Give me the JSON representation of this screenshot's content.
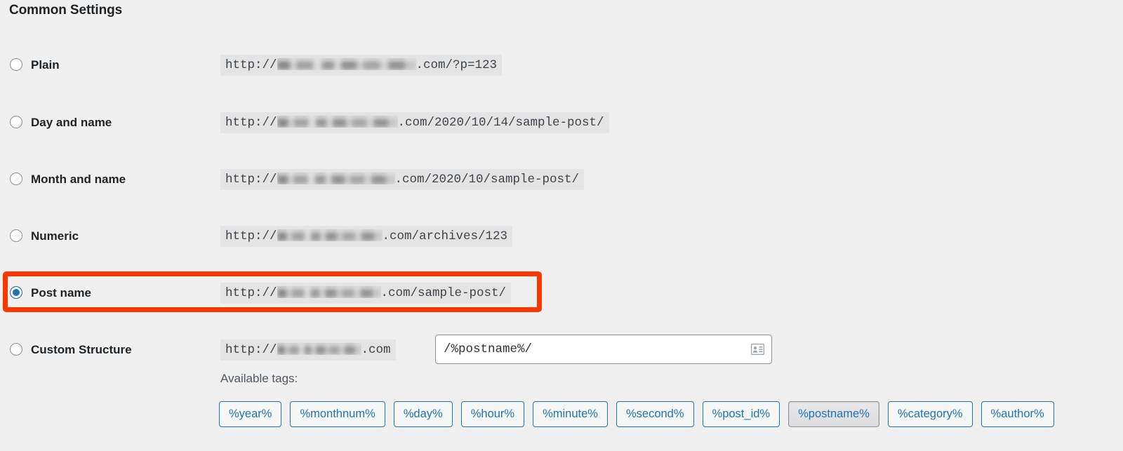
{
  "page": {
    "title": "Common Settings"
  },
  "options": [
    {
      "id": "plain",
      "label": "Plain",
      "selected": false,
      "url_prefix": "http://",
      "url_domain_redacted": true,
      "url_suffix": ".com/?p=123"
    },
    {
      "id": "day-and-name",
      "label": "Day and name",
      "selected": false,
      "url_prefix": "http://",
      "url_domain_redacted": true,
      "url_suffix": ".com/2020/10/14/sample-post/"
    },
    {
      "id": "month-and-name",
      "label": "Month and name",
      "selected": false,
      "url_prefix": "http://",
      "url_domain_redacted": true,
      "url_suffix": ".com/2020/10/sample-post/"
    },
    {
      "id": "numeric",
      "label": "Numeric",
      "selected": false,
      "url_prefix": "http://",
      "url_domain_redacted": true,
      "url_suffix": ".com/archives/123"
    },
    {
      "id": "post-name",
      "label": "Post name",
      "selected": true,
      "url_prefix": "http://",
      "url_domain_redacted": true,
      "url_suffix": ".com/sample-post/"
    },
    {
      "id": "custom-structure",
      "label": "Custom Structure",
      "selected": false,
      "url_prefix": "http://",
      "url_domain_redacted": true,
      "url_suffix": ".com"
    }
  ],
  "custom_structure": {
    "value": "/%postname%/",
    "placeholder": "",
    "autofill_icon": "contact-card-icon"
  },
  "available_tags": {
    "label": "Available tags:",
    "tags": [
      {
        "label": "%year%",
        "pressed": false
      },
      {
        "label": "%monthnum%",
        "pressed": false
      },
      {
        "label": "%day%",
        "pressed": false
      },
      {
        "label": "%hour%",
        "pressed": false
      },
      {
        "label": "%minute%",
        "pressed": false
      },
      {
        "label": "%second%",
        "pressed": false
      },
      {
        "label": "%post_id%",
        "pressed": false
      },
      {
        "label": "%postname%",
        "pressed": true
      },
      {
        "label": "%category%",
        "pressed": false
      },
      {
        "label": "%author%",
        "pressed": false
      }
    ]
  },
  "highlight": {
    "target_option": "post-name",
    "color": "#f93800"
  },
  "colors": {
    "background": "#f0f0f1",
    "accent_blue": "#2271b1",
    "text": "#1d2327",
    "url_band": "#e4e4e5",
    "highlight": "#f93800"
  }
}
